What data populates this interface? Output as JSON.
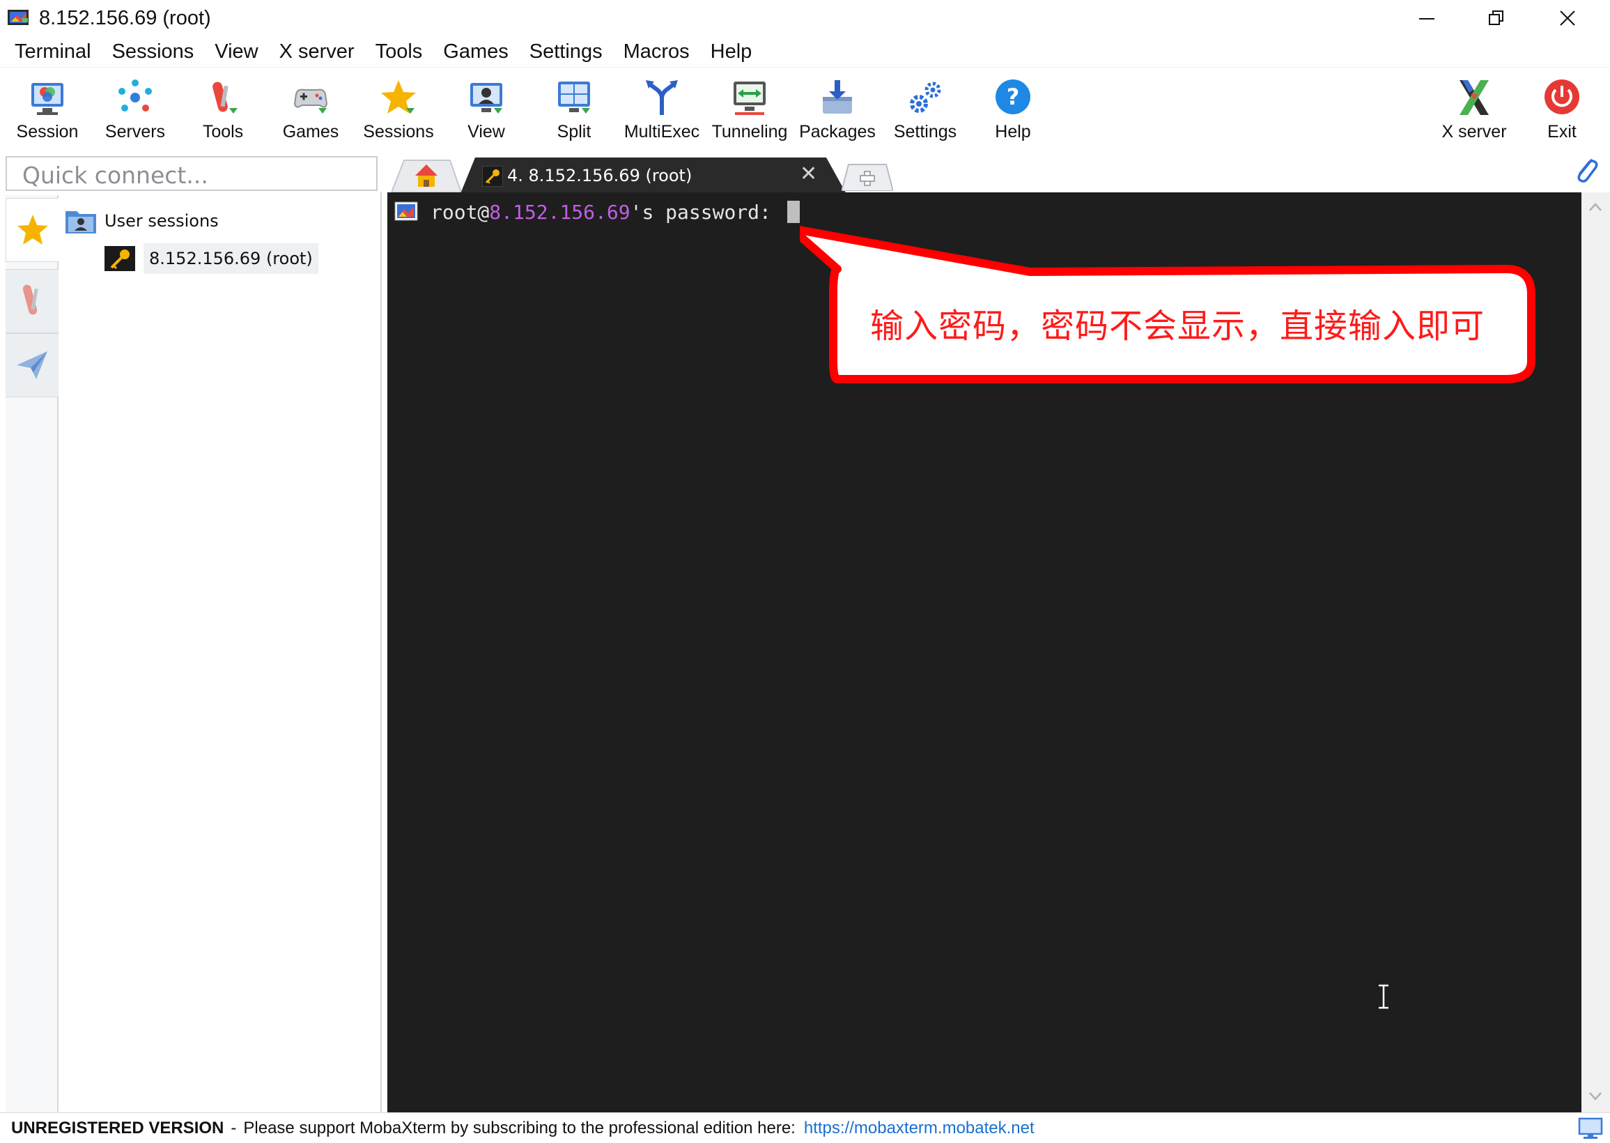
{
  "window": {
    "title": "8.152.156.69 (root)"
  },
  "menu": [
    "Terminal",
    "Sessions",
    "View",
    "X server",
    "Tools",
    "Games",
    "Settings",
    "Macros",
    "Help"
  ],
  "toolbar": {
    "session": "Session",
    "servers": "Servers",
    "tools": "Tools",
    "games": "Games",
    "sessions": "Sessions",
    "view": "View",
    "split": "Split",
    "multiexec": "MultiExec",
    "tunneling": "Tunneling",
    "packages": "Packages",
    "settings": "Settings",
    "help": "Help",
    "xserver": "X server",
    "exit": "Exit"
  },
  "quick_connect": {
    "placeholder": "Quick connect..."
  },
  "tab": {
    "label": "4. 8.152.156.69 (root)",
    "close": "✕"
  },
  "sidebar": {
    "root_label": "User sessions",
    "session_label": "8.152.156.69 (root)"
  },
  "terminal": {
    "prompt_user": "root@",
    "prompt_host": "8.152.156.69",
    "prompt_suffix": "'s password: "
  },
  "callout": {
    "text": "输入密码，密码不会显示，直接输入即可"
  },
  "status": {
    "unregistered": "UNREGISTERED VERSION",
    "separator": "-",
    "message": "Please support MobaXterm by subscribing to the professional edition here:",
    "link": "https://mobaxterm.mobatek.net"
  },
  "colors": {
    "terminal_bg": "#1e1e1e",
    "host_color": "#c05fe0",
    "callout_border": "#ff0000",
    "callout_text": "#ff1a1a",
    "link_color": "#1a6fd1"
  }
}
